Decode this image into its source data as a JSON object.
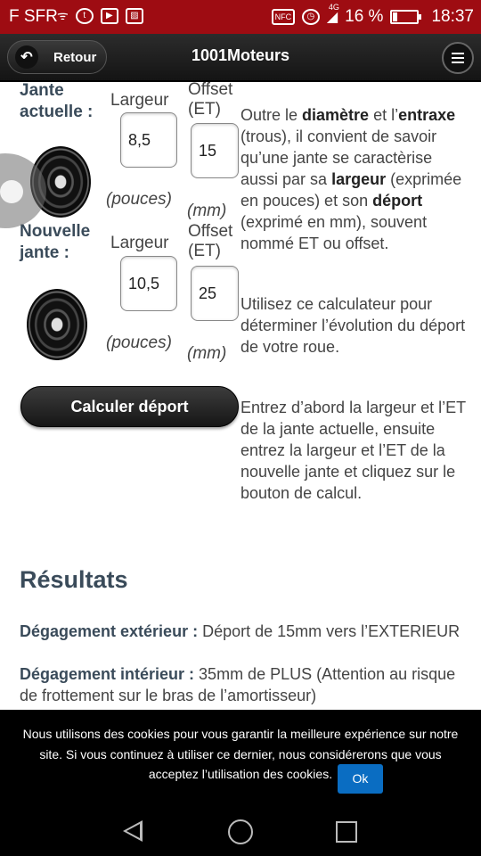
{
  "status_bar": {
    "carrier": "F SFR",
    "network": "4G",
    "battery_percent": "16 %",
    "battery_level": 0.16,
    "time": "18:37",
    "icons": [
      "wifi-icon",
      "tumblr-icon",
      "youtube-icon",
      "image-icon",
      "nfc-icon",
      "alarm-icon",
      "signal-icon",
      "battery-icon"
    ]
  },
  "header": {
    "back_label": "Retour",
    "title": "1001Moteurs",
    "menu_icon": "hamburger-menu-icon"
  },
  "form": {
    "current": {
      "label_line1": "Jante",
      "label_line2": "actuelle :",
      "width_header": "Largeur",
      "offset_header_line1": "Offset",
      "offset_header_line2": "(ET)",
      "width_value": "8,5",
      "offset_value": "15",
      "width_unit": "(pouces)",
      "offset_unit": "(mm)"
    },
    "new": {
      "label_line1": "Nouvelle",
      "label_line2": "jante :",
      "width_header": "Largeur",
      "offset_header_line1": "Offset",
      "offset_header_line2": "(ET)",
      "width_value": "10,5",
      "offset_value": "25",
      "width_unit": "(pouces)",
      "offset_unit": "(mm)"
    },
    "calculate_button": "Calculer déport"
  },
  "help": {
    "p1": [
      {
        "text": "Outre le ",
        "bold": false
      },
      {
        "text": "diamètre",
        "bold": true
      },
      {
        "text": " et l’",
        "bold": false
      },
      {
        "text": "entraxe",
        "bold": true
      },
      {
        "text": " (trous), il convient de savoir qu’une jante se caractèrise aussi par sa ",
        "bold": false
      },
      {
        "text": "largeur",
        "bold": true
      },
      {
        "text": " (exprimée en pouces) et son ",
        "bold": false
      },
      {
        "text": "déport",
        "bold": true
      },
      {
        "text": " (exprimé en mm), souvent nommé ET ou offset.",
        "bold": false
      }
    ],
    "p2": "Utilisez ce calculateur pour déterminer l’évolution du déport de votre roue.",
    "p3": "Entrez d’abord la largeur et l’ET de la jante actuelle, ensuite entrez la largeur et l’ET de la nouvelle jante et cliquez sur le bouton de calcul."
  },
  "results": {
    "title": "Résultats",
    "outer_label": "Dégagement extérieur :",
    "outer_value": " Déport de 15mm vers l’EXTERIEUR",
    "inner_label": "Dégagement intérieur :",
    "inner_value": " 35mm de PLUS (Attention au risque de frottement sur le bras de l’amortisseur)"
  },
  "cookie_banner": {
    "text": "Nous utilisons des cookies pour vous garantir la meilleure expérience sur notre site. Si vous continuez à utiliser ce dernier, nous considérerons que vous acceptez l’utilisation des cookies.",
    "ok_label": "Ok"
  },
  "colors": {
    "status_bar": "#9e0c12",
    "heading": "#3a4b5a",
    "ok_button": "#0a6dc2"
  }
}
